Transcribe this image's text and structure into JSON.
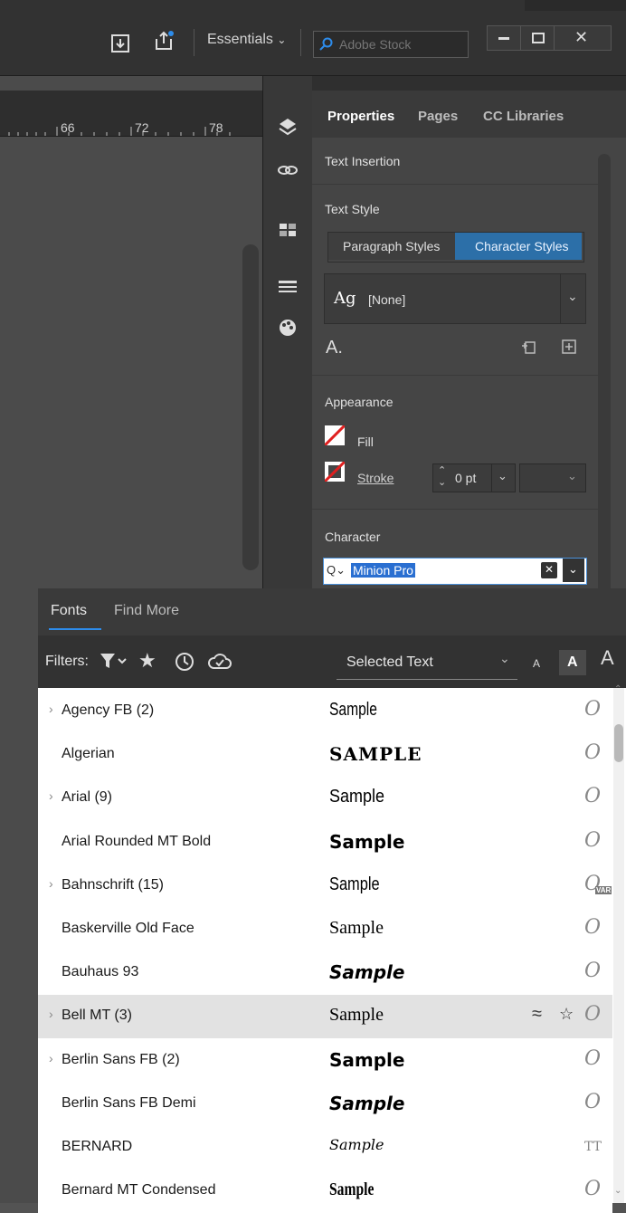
{
  "topbar": {
    "workspace_label": "Essentials",
    "search_placeholder": "Adobe Stock"
  },
  "ruler": {
    "marks": [
      "66",
      "72",
      "78"
    ]
  },
  "panel": {
    "tabs": [
      "Properties",
      "Pages",
      "CC Libraries"
    ],
    "text_insertion": "Text Insertion",
    "text_style": "Text Style",
    "paragraph_styles": "Paragraph Styles",
    "character_styles": "Character Styles",
    "style_glyph": "Ag",
    "style_value": "[None]",
    "clear_glyph": "A.",
    "appearance": "Appearance",
    "fill": "Fill",
    "stroke": "Stroke",
    "stroke_value": "0 pt",
    "character": "Character",
    "font_value": "Minion Pro"
  },
  "fontmenu": {
    "tabs": [
      "Fonts",
      "Find More"
    ],
    "filters_label": "Filters:",
    "preview_mode": "Selected Text",
    "size_small": "A",
    "size_medium": "A",
    "size_large": "A",
    "fonts": [
      {
        "name": "Agency FB (2)",
        "sample": "Sample",
        "expandable": true,
        "type": "O"
      },
      {
        "name": "Algerian",
        "sample": "SAMPLE",
        "expandable": false,
        "type": "O"
      },
      {
        "name": "Arial (9)",
        "sample": "Sample",
        "expandable": true,
        "type": "O"
      },
      {
        "name": "Arial Rounded MT Bold",
        "sample": "Sample",
        "expandable": false,
        "type": "O"
      },
      {
        "name": "Bahnschrift (15)",
        "sample": "Sample",
        "expandable": true,
        "type": "O",
        "badge": "VAR"
      },
      {
        "name": "Baskerville Old Face",
        "sample": "Sample",
        "expandable": false,
        "type": "O"
      },
      {
        "name": "Bauhaus 93",
        "sample": "Sample",
        "expandable": false,
        "type": "O"
      },
      {
        "name": "Bell MT (3)",
        "sample": "Sample",
        "expandable": true,
        "type": "O",
        "highlighted": true
      },
      {
        "name": "Berlin Sans FB (2)",
        "sample": "Sample",
        "expandable": true,
        "type": "O"
      },
      {
        "name": "Berlin Sans FB Demi",
        "sample": "Sample",
        "expandable": false,
        "type": "O"
      },
      {
        "name": "BERNARD",
        "sample": "Sample",
        "expandable": false,
        "type": "TT"
      },
      {
        "name": "Bernard MT Condensed",
        "sample": "Sample",
        "expandable": false,
        "type": "O"
      }
    ]
  }
}
